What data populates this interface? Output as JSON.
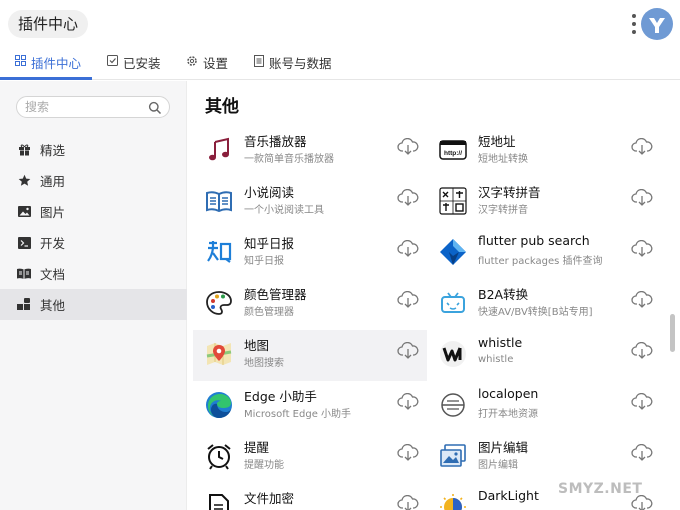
{
  "header": {
    "title": "插件中心"
  },
  "tabs": [
    {
      "label": "插件中心",
      "icon": "grid-icon"
    },
    {
      "label": "已安装",
      "icon": "check-square-icon"
    },
    {
      "label": "设置",
      "icon": "gear-icon"
    },
    {
      "label": "账号与数据",
      "icon": "document-icon"
    }
  ],
  "sidebar": {
    "search_placeholder": "搜索",
    "items": [
      {
        "label": "精选",
        "icon": "gift-icon"
      },
      {
        "label": "通用",
        "icon": "star-icon"
      },
      {
        "label": "图片",
        "icon": "image-icon"
      },
      {
        "label": "开发",
        "icon": "terminal-icon"
      },
      {
        "label": "文档",
        "icon": "book-icon"
      },
      {
        "label": "其他",
        "icon": "shapes-icon",
        "active": true
      }
    ]
  },
  "main": {
    "section_title": "其他",
    "plugins": [
      {
        "name": "音乐播放器",
        "desc": "一款简单音乐播放器",
        "icon": "music-note-icon"
      },
      {
        "name": "短地址",
        "desc": "短地址转换",
        "icon": "http-link-icon"
      },
      {
        "name": "小说阅读",
        "desc": "一个小说阅读工具",
        "icon": "open-book-icon"
      },
      {
        "name": "汉字转拼音",
        "desc": "汉字转拼音",
        "icon": "hanzi-pinyin-icon"
      },
      {
        "name": "知乎日报",
        "desc": "知乎日报",
        "icon": "zhihu-icon"
      },
      {
        "name": "flutter pub search",
        "desc": "flutter packages 插件查询",
        "icon": "flutter-icon"
      },
      {
        "name": "颜色管理器",
        "desc": "颜色管理器",
        "icon": "palette-icon"
      },
      {
        "name": "B2A转换",
        "desc": "快速AV/BV转换[B站专用]",
        "icon": "bilibili-tv-icon"
      },
      {
        "name": "地图",
        "desc": "地图搜索",
        "icon": "map-icon"
      },
      {
        "name": "whistle",
        "desc": "whistle",
        "icon": "whistle-icon"
      },
      {
        "name": "Edge 小助手",
        "desc": "Microsoft Edge 小助手",
        "icon": "edge-icon"
      },
      {
        "name": "localopen",
        "desc": "打开本地资源",
        "icon": "localopen-icon"
      },
      {
        "name": "提醒",
        "desc": "提醒功能",
        "icon": "alarm-clock-icon"
      },
      {
        "name": "图片编辑",
        "desc": "图片编辑",
        "icon": "image-edit-icon"
      },
      {
        "name": "文件加密",
        "desc": "",
        "icon": "file-lock-icon"
      },
      {
        "name": "DarkLight",
        "desc": "",
        "icon": "darklight-icon"
      }
    ]
  },
  "watermark": "SMYZ.NET",
  "colors": {
    "accent": "#3b6fd6",
    "sidebar_bg": "#f6f6f7",
    "highlight_bg": "#f2f2f4"
  }
}
